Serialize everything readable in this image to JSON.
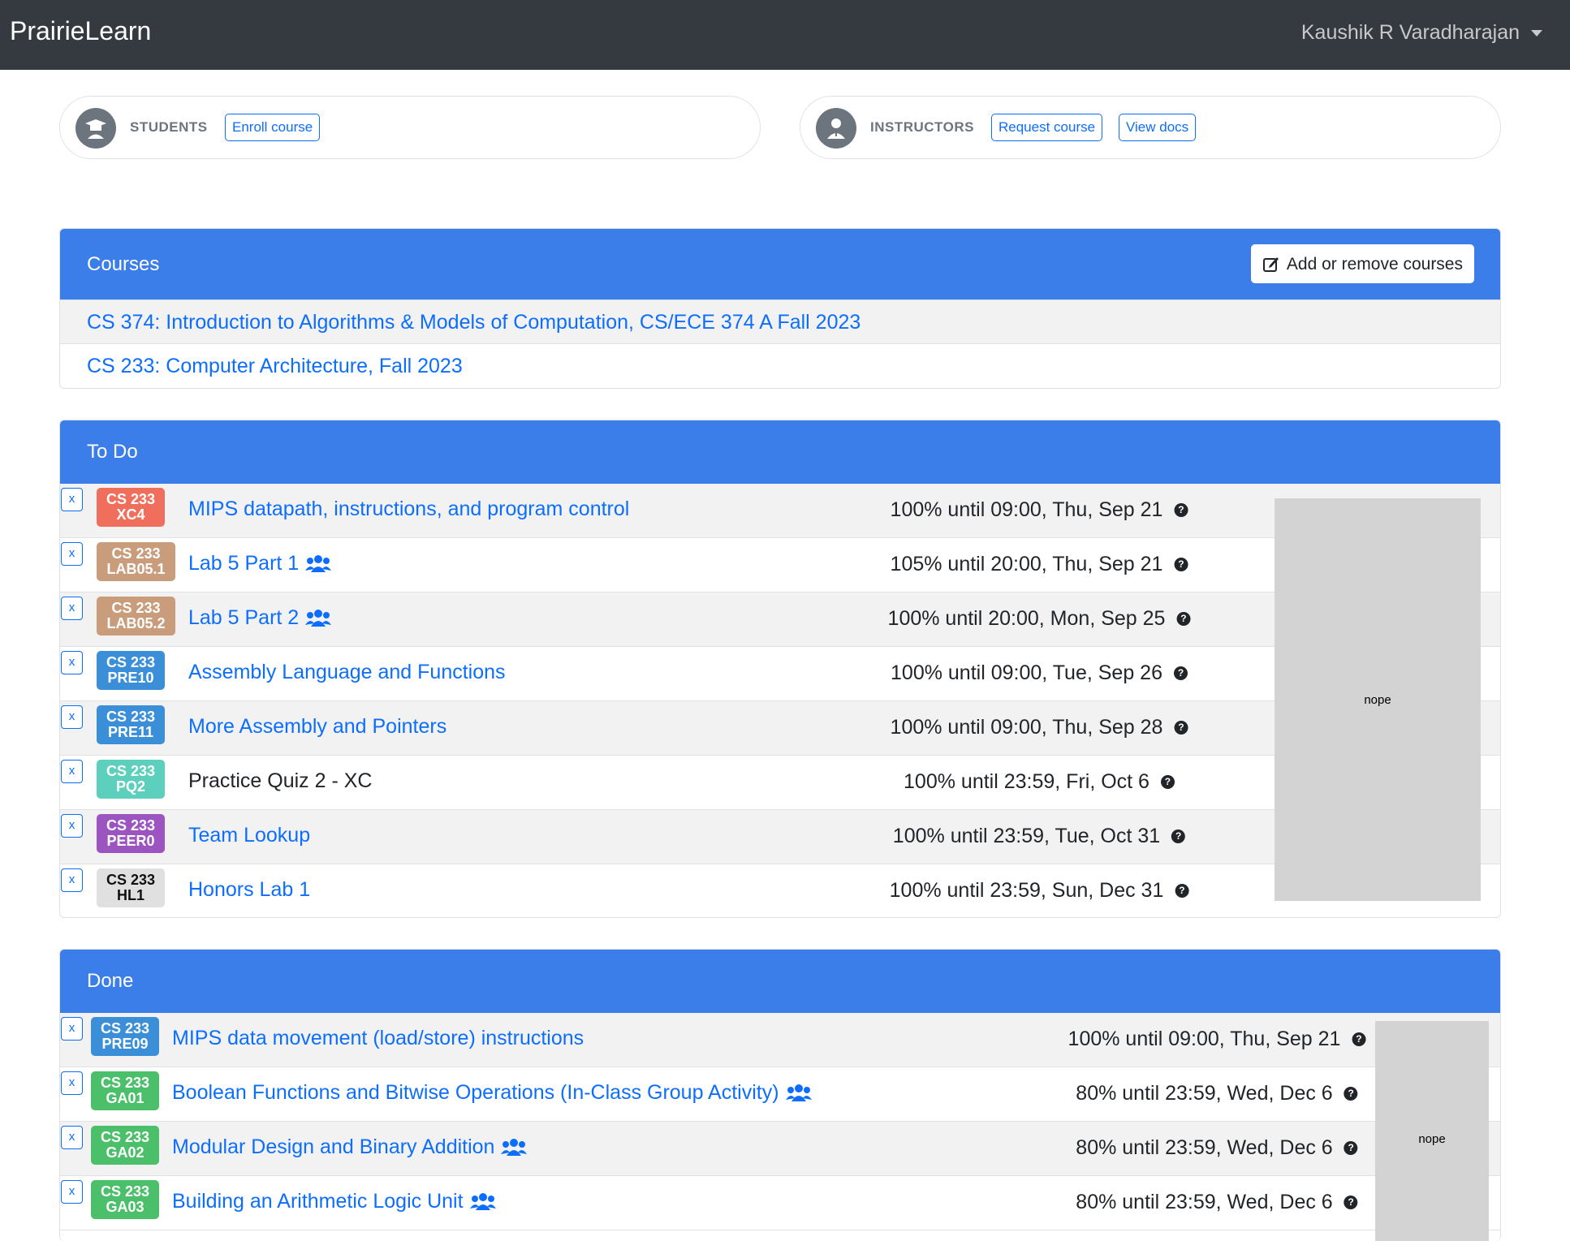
{
  "navbar": {
    "brand": "PrairieLearn",
    "user": "Kaushik R Varadharajan"
  },
  "students": {
    "label": "STUDENTS",
    "enroll": "Enroll course"
  },
  "instructors": {
    "label": "INSTRUCTORS",
    "request": "Request course",
    "docs": "View docs"
  },
  "courses": {
    "title": "Courses",
    "add_button": "Add or remove courses",
    "items": [
      "CS 374: Introduction to Algorithms & Models of Computation, CS/ECE 374 A Fall 2023",
      "CS 233: Computer Architecture, Fall 2023"
    ]
  },
  "todo": {
    "title": "To Do",
    "ad": "nope",
    "rows": [
      {
        "x": "x",
        "badge_top": "CS 233",
        "badge_bottom": "XC4",
        "badge_color": "#ef6f5c",
        "title": "MIPS datapath, instructions, and program control",
        "group": false,
        "link": true,
        "due": "100% until 09:00, Thu, Sep 21"
      },
      {
        "x": "x",
        "badge_top": "CS 233",
        "badge_bottom": "LAB05.1",
        "badge_color": "#c99c7c",
        "title": "Lab 5 Part 1",
        "group": true,
        "link": true,
        "due": "105% until 20:00, Thu, Sep 21"
      },
      {
        "x": "x",
        "badge_top": "CS 233",
        "badge_bottom": "LAB05.2",
        "badge_color": "#c99c7c",
        "title": "Lab 5 Part 2",
        "group": true,
        "link": true,
        "due": "100% until 20:00, Mon, Sep 25"
      },
      {
        "x": "x",
        "badge_top": "CS 233",
        "badge_bottom": "PRE10",
        "badge_color": "#3b8fd9",
        "title": "Assembly Language and Functions",
        "group": false,
        "link": true,
        "due": "100% until 09:00, Tue, Sep 26"
      },
      {
        "x": "x",
        "badge_top": "CS 233",
        "badge_bottom": "PRE11",
        "badge_color": "#3b8fd9",
        "title": "More Assembly and Pointers",
        "group": false,
        "link": true,
        "due": "100% until 09:00, Thu, Sep 28"
      },
      {
        "x": "x",
        "badge_top": "CS 233",
        "badge_bottom": "PQ2",
        "badge_color": "#5ccfbd",
        "title": "Practice Quiz 2 - XC",
        "group": false,
        "link": false,
        "due": "100% until 23:59, Fri, Oct 6"
      },
      {
        "x": "x",
        "badge_top": "CS 233",
        "badge_bottom": "PEER0",
        "badge_color": "#9b54c0",
        "title": "Team Lookup",
        "group": false,
        "link": true,
        "due": "100% until 23:59, Tue, Oct 31"
      },
      {
        "x": "x",
        "badge_top": "CS 233",
        "badge_bottom": "HL1",
        "badge_color": "#e0e0e0",
        "badge_text": "#111111",
        "title": "Honors Lab 1",
        "group": false,
        "link": true,
        "due": "100% until 23:59, Sun, Dec 31"
      }
    ]
  },
  "done": {
    "title": "Done",
    "ad": "nope",
    "rows": [
      {
        "x": "x",
        "badge_top": "CS 233",
        "badge_bottom": "PRE09",
        "badge_color": "#3b8fd9",
        "title": "MIPS data movement (load/store) instructions",
        "group": false,
        "link": true,
        "due": "100% until 09:00, Thu, Sep 21"
      },
      {
        "x": "x",
        "badge_top": "CS 233",
        "badge_bottom": "GA01",
        "badge_color": "#4cbf6a",
        "title": "Boolean Functions and Bitwise Operations (In-Class Group Activity)",
        "group": true,
        "link": true,
        "due": "80% until 23:59, Wed, Dec 6"
      },
      {
        "x": "x",
        "badge_top": "CS 233",
        "badge_bottom": "GA02",
        "badge_color": "#4cbf6a",
        "title": "Modular Design and Binary Addition",
        "group": true,
        "link": true,
        "due": "80% until 23:59, Wed, Dec 6"
      },
      {
        "x": "x",
        "badge_top": "CS 233",
        "badge_bottom": "GA03",
        "badge_color": "#4cbf6a",
        "title": "Building an Arithmetic Logic Unit",
        "group": true,
        "link": true,
        "due": "80% until 23:59, Wed, Dec 6"
      }
    ]
  }
}
